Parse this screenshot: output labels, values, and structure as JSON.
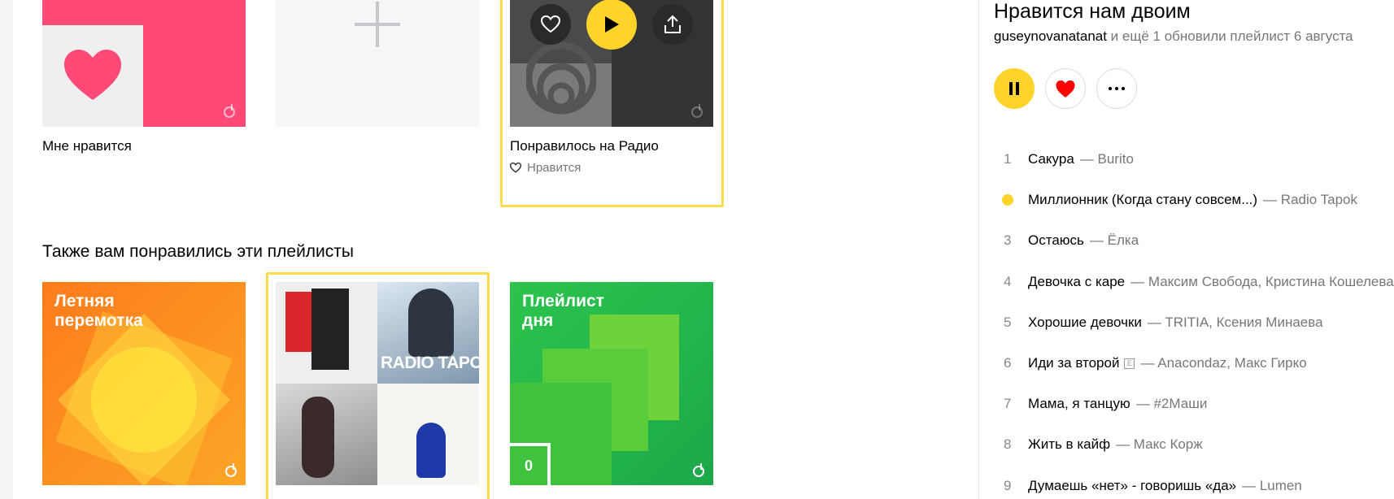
{
  "playlists_top": [
    {
      "title": "Мне нравится"
    },
    {
      "title": ""
    },
    {
      "title": "Понравилось на Радио",
      "like_label": "Нравится"
    }
  ],
  "section": {
    "title": "Также вам понравились эти плейлисты"
  },
  "playlists_bottom": [
    {
      "cover_text": "Летняя\nперемотка"
    },
    {
      "cover_text": "RADIO TAPOK"
    },
    {
      "cover_text": "Плейлист\nдня",
      "badge": "0"
    }
  ],
  "panel": {
    "title": "Нравится нам двоим",
    "owner": "guseynovanatanat",
    "updated": " и ещё 1 обновили плейлист 6 августа"
  },
  "tracks": [
    {
      "num": "1",
      "title": "Сакура",
      "artist": "— Burito"
    },
    {
      "num": "",
      "title": "Миллионник (Когда стану совсем...)",
      "artist": "— Radio Tapok",
      "playing": true
    },
    {
      "num": "3",
      "title": "Остаюсь",
      "artist": "— Ёлка"
    },
    {
      "num": "4",
      "title": "Девочка с каре",
      "artist": "— Максим Свобода, Кристина Кошелева"
    },
    {
      "num": "5",
      "title": "Хорошие девочки",
      "artist": "— TRITIA, Ксения Минаева"
    },
    {
      "num": "6",
      "title": "Иди за второй",
      "artist": "— Anacondaz, Макс Гирко",
      "explicit": "E"
    },
    {
      "num": "7",
      "title": "Мама, я танцую",
      "artist": "— #2Маши"
    },
    {
      "num": "8",
      "title": "Жить в кайф",
      "artist": "— Макс Корж"
    },
    {
      "num": "9",
      "title": "Думаешь «нет» - говоришь «да»",
      "artist": "— Lumen"
    }
  ],
  "colors": {
    "accent_yellow": "#ffdb4d",
    "like_red": "#ff0000",
    "favorites_pink": "#ff4a78",
    "summer_orange": "#fc8a1f",
    "daily_green": "#2fbf4f"
  },
  "icons": [
    "heart-icon",
    "plus-icon",
    "play-icon",
    "share-icon",
    "pause-icon",
    "more-icon",
    "music-note-icon"
  ]
}
